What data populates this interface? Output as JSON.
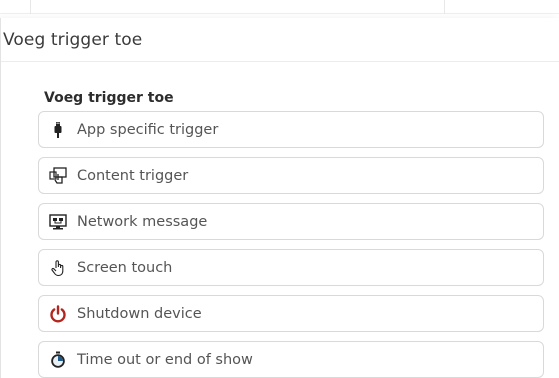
{
  "modal": {
    "title": "Voeg trigger toe"
  },
  "section": {
    "title": "Voeg trigger toe"
  },
  "triggers": [
    {
      "label": "App specific trigger",
      "icon": "usb-plug-icon"
    },
    {
      "label": "Content trigger",
      "icon": "content-touch-icon"
    },
    {
      "label": "Network message",
      "icon": "network-monitor-icon"
    },
    {
      "label": "Screen touch",
      "icon": "hand-touch-icon"
    },
    {
      "label": "Shutdown device",
      "icon": "power-icon"
    },
    {
      "label": "Time out or end of show",
      "icon": "stopwatch-icon"
    }
  ],
  "colors": {
    "power": "#b3261e",
    "stopwatch": "#1f5a8a",
    "icon_dark": "#222222"
  }
}
